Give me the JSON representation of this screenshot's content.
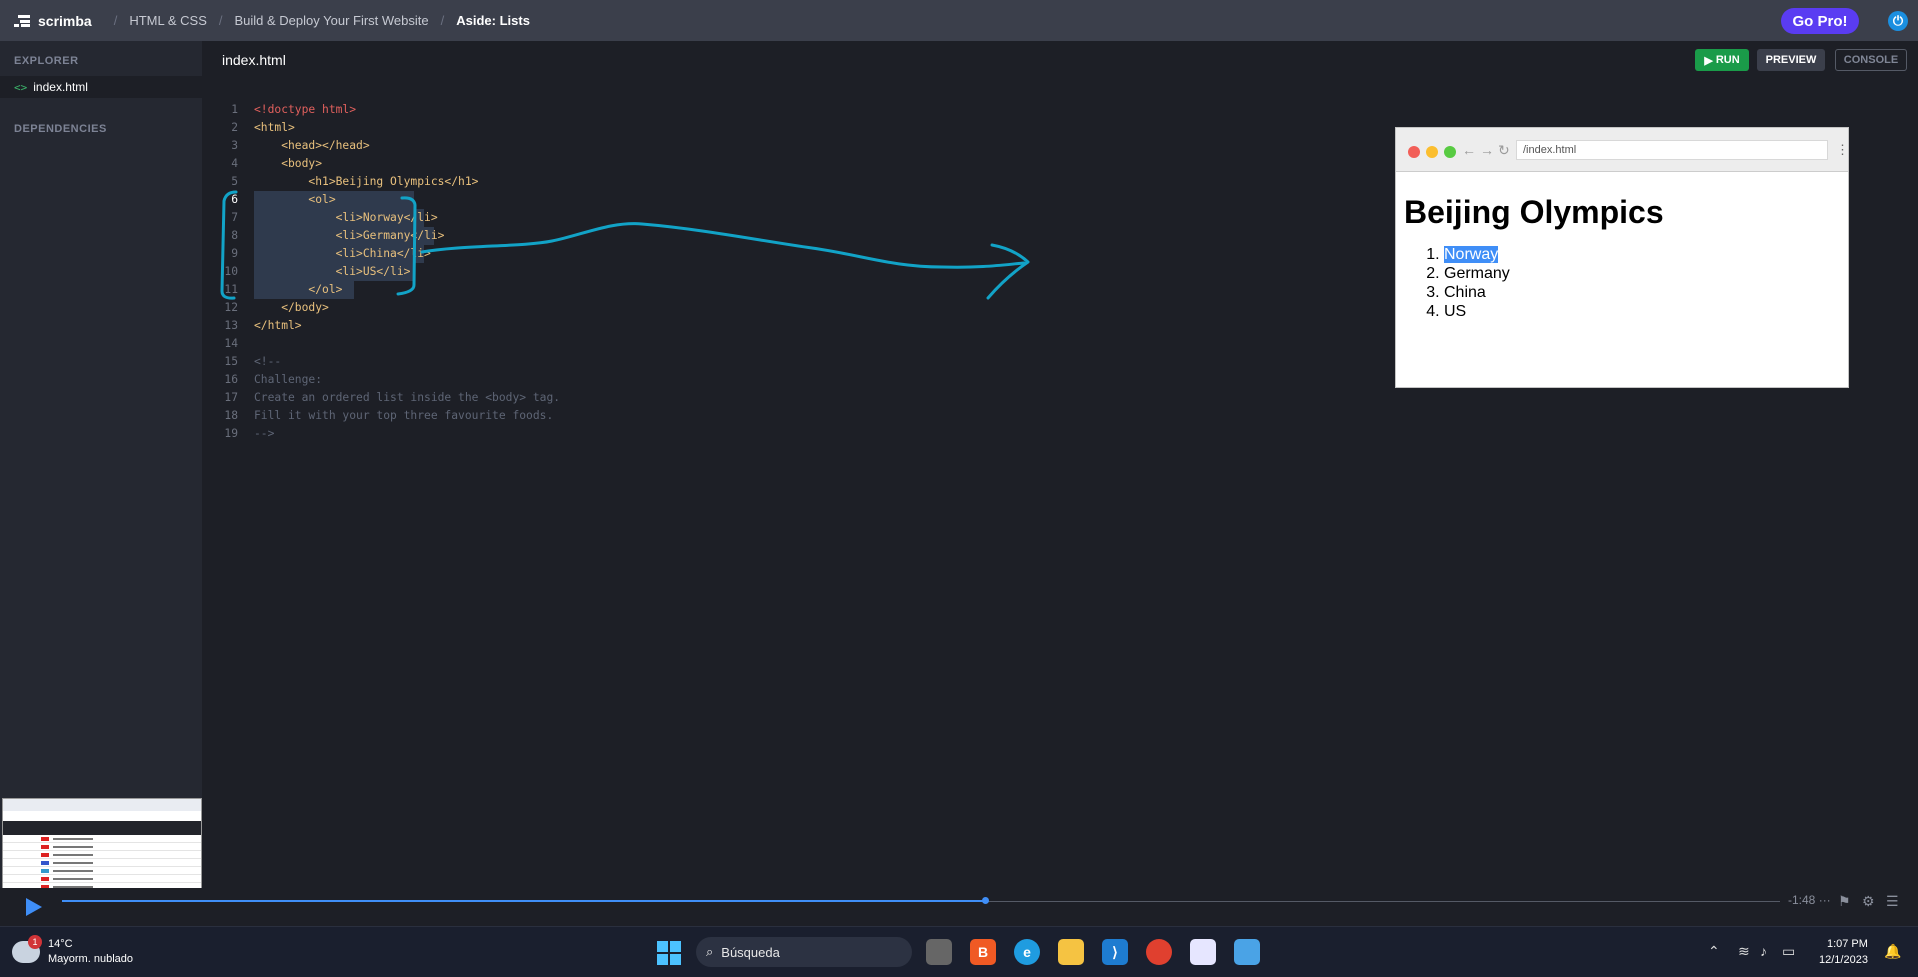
{
  "topbar": {
    "brand": "scrimba",
    "breadcrumbs": [
      "HTML & CSS",
      "Build & Deploy Your First Website",
      "Aside: Lists"
    ],
    "go_pro": "Go Pro!"
  },
  "sidebar": {
    "explorer_label": "EXPLORER",
    "file": "index.html",
    "dependencies_label": "DEPENDENCIES"
  },
  "editor": {
    "tab": "index.html",
    "run_label": "RUN",
    "preview_label": "PREVIEW",
    "console_label": "CONSOLE",
    "lines": [
      {
        "n": "1",
        "text": "<!doctype html>"
      },
      {
        "n": "2",
        "text": "<html>"
      },
      {
        "n": "3",
        "text": "    <head></head>"
      },
      {
        "n": "4",
        "text": "    <body>"
      },
      {
        "n": "5",
        "text": "        <h1>Beijing Olympics</h1>"
      },
      {
        "n": "6",
        "text": "        <ol>"
      },
      {
        "n": "7",
        "text": "            <li>Norway</li>"
      },
      {
        "n": "8",
        "text": "            <li>Germany</li>"
      },
      {
        "n": "9",
        "text": "            <li>China</li>"
      },
      {
        "n": "10",
        "text": "            <li>US</li>"
      },
      {
        "n": "11",
        "text": "        </ol>"
      },
      {
        "n": "12",
        "text": "    </body>"
      },
      {
        "n": "13",
        "text": "</html>"
      },
      {
        "n": "14",
        "text": ""
      },
      {
        "n": "15",
        "text": "<!--"
      },
      {
        "n": "16",
        "text": "Challenge:"
      },
      {
        "n": "17",
        "text": "Create an ordered list inside the <body> tag."
      },
      {
        "n": "18",
        "text": "Fill it with your top three favourite foods."
      },
      {
        "n": "19",
        "text": "-->"
      }
    ]
  },
  "preview": {
    "address": "/index.html",
    "heading": "Beijing Olympics",
    "items": [
      "Norway",
      "Germany",
      "China",
      "US"
    ]
  },
  "player": {
    "time_remaining": "-1:48",
    "progress": 0.538
  },
  "taskbar": {
    "temperature": "14°C",
    "weather": "Mayorm. nublado",
    "weather_badge": "1",
    "search_placeholder": "Búsqueda",
    "time": "1:07 PM",
    "date": "12/1/2023"
  },
  "colors": {
    "accent_blue": "#3f8ef7",
    "annotation": "#12a3c7",
    "run_green": "#1a9b49",
    "go_pro_purple": "#5a3cf2"
  }
}
